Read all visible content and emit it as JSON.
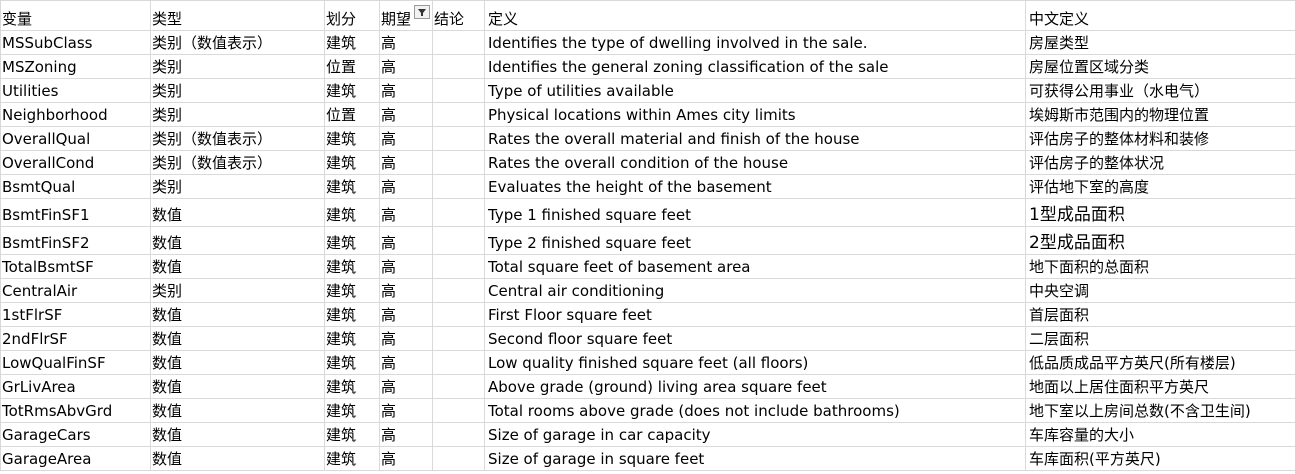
{
  "headers": {
    "variable": "变量",
    "type": "类型",
    "division": "划分",
    "expectation": "期望",
    "conclusion": "结论",
    "definition": "定义",
    "zh_definition": "中文定义"
  },
  "filter_icon": "filter-funnel-icon",
  "rows": [
    {
      "variable": "MSSubClass",
      "type": "类别（数值表示）",
      "division": "建筑",
      "expectation": "高",
      "conclusion": "",
      "definition": "Identifies the type of dwelling involved in the sale.",
      "zh_definition": "房屋类型"
    },
    {
      "variable": "MSZoning",
      "type": "类别",
      "division": "位置",
      "expectation": "高",
      "conclusion": "",
      "definition": "Identifies the general zoning classification of the sale",
      "zh_definition": "房屋位置区域分类"
    },
    {
      "variable": "Utilities",
      "type": "类别",
      "division": "建筑",
      "expectation": "高",
      "conclusion": "",
      "definition": "Type of utilities available",
      "zh_definition": "可获得公用事业（水电气）"
    },
    {
      "variable": "Neighborhood",
      "type": "类别",
      "division": "位置",
      "expectation": "高",
      "conclusion": "",
      "definition": "Physical locations within Ames city limits",
      "zh_definition": "埃姆斯市范围内的物理位置"
    },
    {
      "variable": "OverallQual",
      "type": "类别（数值表示）",
      "division": "建筑",
      "expectation": "高",
      "conclusion": "",
      "definition": "Rates the overall material and finish of the house",
      "zh_definition": "评估房子的整体材料和装修"
    },
    {
      "variable": "OverallCond",
      "type": "类别（数值表示）",
      "division": "建筑",
      "expectation": "高",
      "conclusion": "",
      "definition": "Rates the overall condition of the house",
      "zh_definition": "评估房子的整体状况"
    },
    {
      "variable": "BsmtQual",
      "type": "类别",
      "division": "建筑",
      "expectation": "高",
      "conclusion": "",
      "definition": "Evaluates the height of the basement",
      "zh_definition": "评估地下室的高度"
    },
    {
      "variable": "BsmtFinSF1",
      "type": "数值",
      "division": "建筑",
      "expectation": "高",
      "conclusion": "",
      "definition": "Type 1 finished square feet",
      "zh_definition": "1型成品面积"
    },
    {
      "variable": "BsmtFinSF2",
      "type": "数值",
      "division": "建筑",
      "expectation": "高",
      "conclusion": "",
      "definition": "Type 2 finished square feet",
      "zh_definition": "2型成品面积"
    },
    {
      "variable": "TotalBsmtSF",
      "type": "数值",
      "division": "建筑",
      "expectation": "高",
      "conclusion": "",
      "definition": "Total square feet of basement area",
      "zh_definition": "地下面积的总面积"
    },
    {
      "variable": "CentralAir",
      "type": "类别",
      "division": "建筑",
      "expectation": "高",
      "conclusion": "",
      "definition": "Central air conditioning",
      "zh_definition": "中央空调"
    },
    {
      "variable": "1stFlrSF",
      "type": "数值",
      "division": "建筑",
      "expectation": "高",
      "conclusion": "",
      "definition": "First Floor square feet",
      "zh_definition": "首层面积"
    },
    {
      "variable": "2ndFlrSF",
      "type": "数值",
      "division": "建筑",
      "expectation": "高",
      "conclusion": "",
      "definition": "Second floor square feet",
      "zh_definition": "二层面积"
    },
    {
      "variable": "LowQualFinSF",
      "type": "数值",
      "division": "建筑",
      "expectation": "高",
      "conclusion": "",
      "definition": "Low quality finished square feet (all floors)",
      "zh_definition": "低品质成品平方英尺(所有楼层)"
    },
    {
      "variable": "GrLivArea",
      "type": "数值",
      "division": "建筑",
      "expectation": "高",
      "conclusion": "",
      "definition": " Above grade (ground) living area square feet",
      "zh_definition": "地面以上居住面积平方英尺"
    },
    {
      "variable": "TotRmsAbvGrd",
      "type": "数值",
      "division": "建筑",
      "expectation": "高",
      "conclusion": "",
      "definition": "Total rooms above grade (does not include bathrooms)",
      "zh_definition": "地下室以上房间总数(不含卫生间)"
    },
    {
      "variable": "GarageCars",
      "type": "数值",
      "division": "建筑",
      "expectation": "高",
      "conclusion": "",
      "definition": "Size of garage in car capacity",
      "zh_definition": "车库容量的大小"
    },
    {
      "variable": "GarageArea",
      "type": "数值",
      "division": "建筑",
      "expectation": "高",
      "conclusion": "",
      "definition": "Size of garage in square feet",
      "zh_definition": "车库面积(平方英尺)"
    }
  ]
}
